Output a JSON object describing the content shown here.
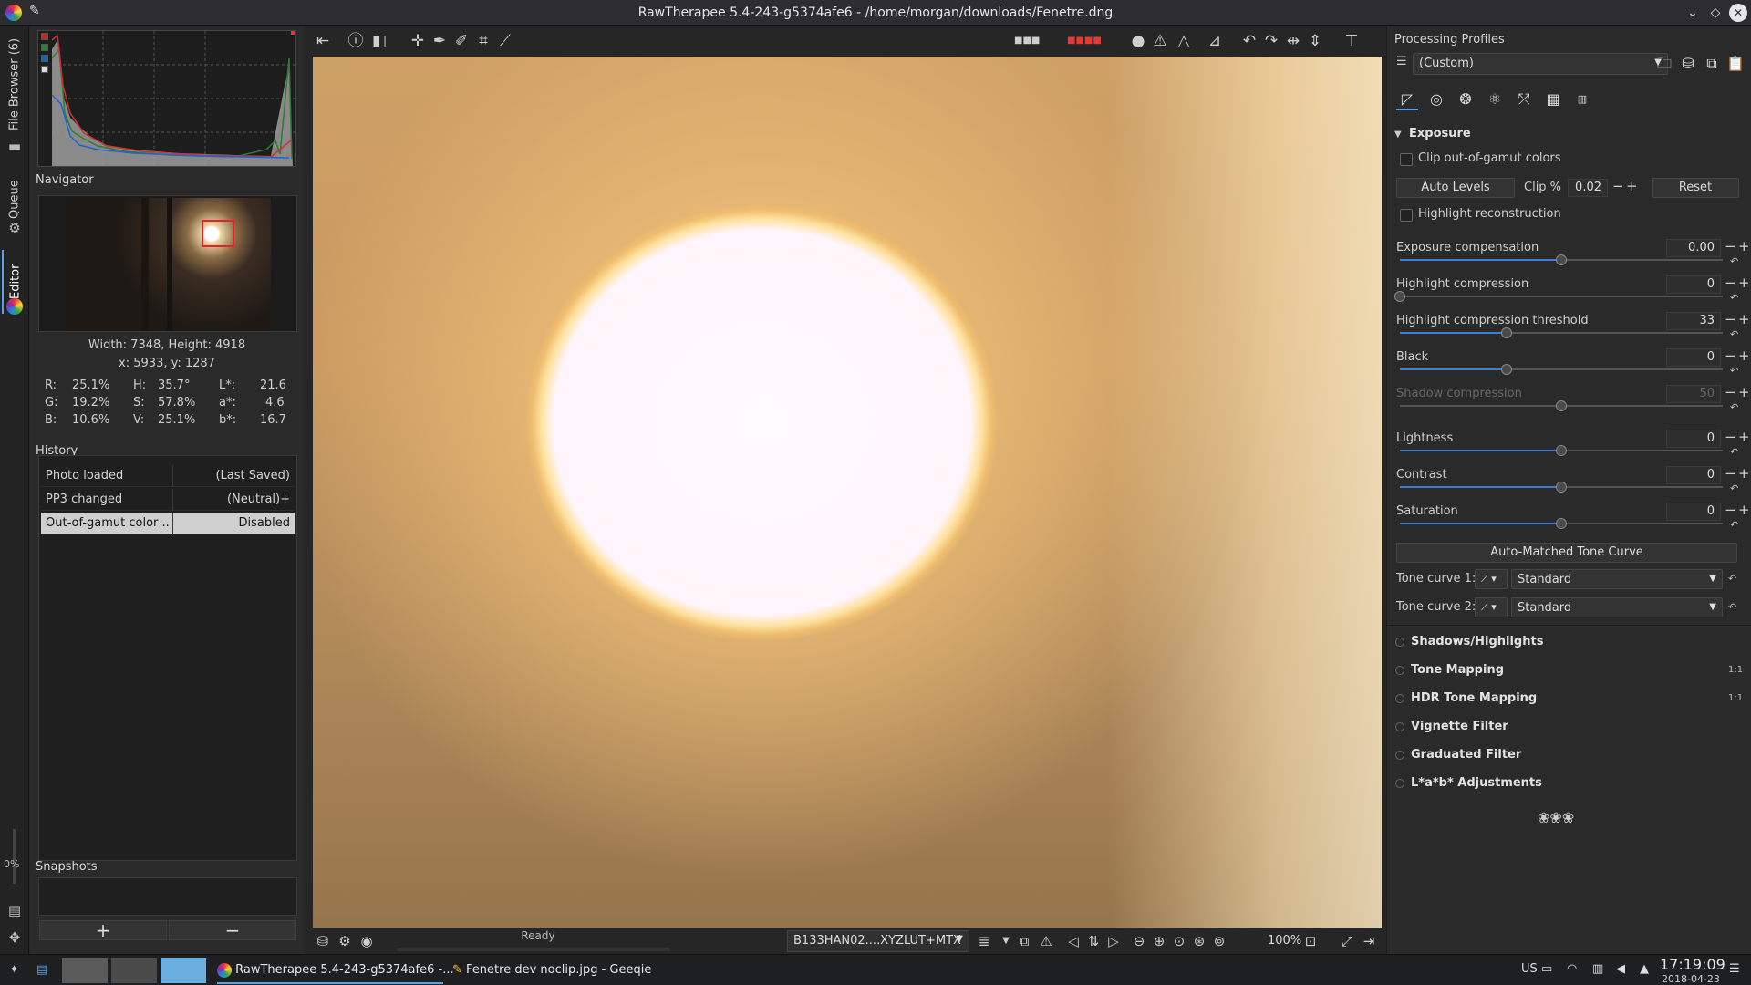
{
  "window": {
    "title": "RawTherapee 5.4-243-g5374afe6 - /home/morgan/downloads/Fenetre.dng"
  },
  "vtabs": {
    "file_browser": "File Browser (6)",
    "queue": "Queue",
    "editor": "Editor",
    "progress": "0%"
  },
  "navigator": {
    "header": "Navigator",
    "dimensions": "Width: 7348, Height: 4918",
    "coords": "x: 5933, y: 1287",
    "r_label": "R:",
    "r_value": "25.1%",
    "g_label": "G:",
    "g_value": "19.2%",
    "b_label": "B:",
    "b_value": "10.6%",
    "h_label": "H:",
    "h_value": "35.7°",
    "s_label": "S:",
    "s_value": "57.8%",
    "v_label": "V:",
    "v_value": "25.1%",
    "l_label": "L*:",
    "l_value": "21.6",
    "a_label": "a*:",
    "a_value": "4.6",
    "bb_label": "b*:",
    "bb_value": "16.7"
  },
  "history": {
    "header": "History",
    "rows": [
      {
        "action": "Photo loaded",
        "value": "(Last Saved)"
      },
      {
        "action": "PP3 changed",
        "value": "(Neutral)+"
      },
      {
        "action": "Out-of-gamut color ...",
        "value": "Disabled"
      }
    ]
  },
  "snapshots": {
    "header": "Snapshots",
    "add": "+",
    "remove": "−"
  },
  "status": {
    "text": "Ready"
  },
  "bottombar": {
    "profile": "B133HAN02....XYZLUT+MTX",
    "zoom": "100%"
  },
  "profiles": {
    "header": "Processing Profiles",
    "current": "(Custom)"
  },
  "exposure": {
    "header": "Exposure",
    "clip_gamut": "Clip out-of-gamut colors",
    "auto_levels": "Auto Levels",
    "clip_label": "Clip %",
    "clip_value": "0.02",
    "reset": "Reset",
    "highlight_recon": "Highlight reconstruction",
    "sliders": [
      {
        "label": "Exposure compensation",
        "value": "0.00",
        "level": 0.5
      },
      {
        "label": "Highlight compression",
        "value": "0",
        "level": 0.0
      },
      {
        "label": "Highlight compression threshold",
        "value": "33",
        "level": 0.33
      },
      {
        "label": "Black",
        "value": "0",
        "level": 0.33
      },
      {
        "label": "Shadow compression",
        "value": "50",
        "level": 0.5
      },
      {
        "label": "Lightness",
        "value": "0",
        "level": 0.5
      },
      {
        "label": "Contrast",
        "value": "0",
        "level": 0.5
      },
      {
        "label": "Saturation",
        "value": "0",
        "level": 0.5
      }
    ],
    "auto_matched": "Auto-Matched Tone Curve",
    "tone_curve_1": "Tone curve 1:",
    "tone_curve_2": "Tone curve 2:",
    "curve_mode": "Standard"
  },
  "tools": [
    "Shadows/Highlights",
    "Tone Mapping",
    "HDR Tone Mapping",
    "Vignette Filter",
    "Graduated Filter",
    "L*a*b* Adjustments"
  ],
  "tool_badge": "1:1",
  "taskbar": {
    "app1": "RawTherapee 5.4-243-g5374afe6 -...",
    "app2": "Fenetre dev noclip.jpg - Geeqie",
    "lang": "US",
    "time": "17:19:09",
    "date": "2018-04-23"
  },
  "colors": {
    "accent": "#3d7fd0",
    "panel": "#2a2a2a",
    "selected_row": "#cfcfcf"
  }
}
